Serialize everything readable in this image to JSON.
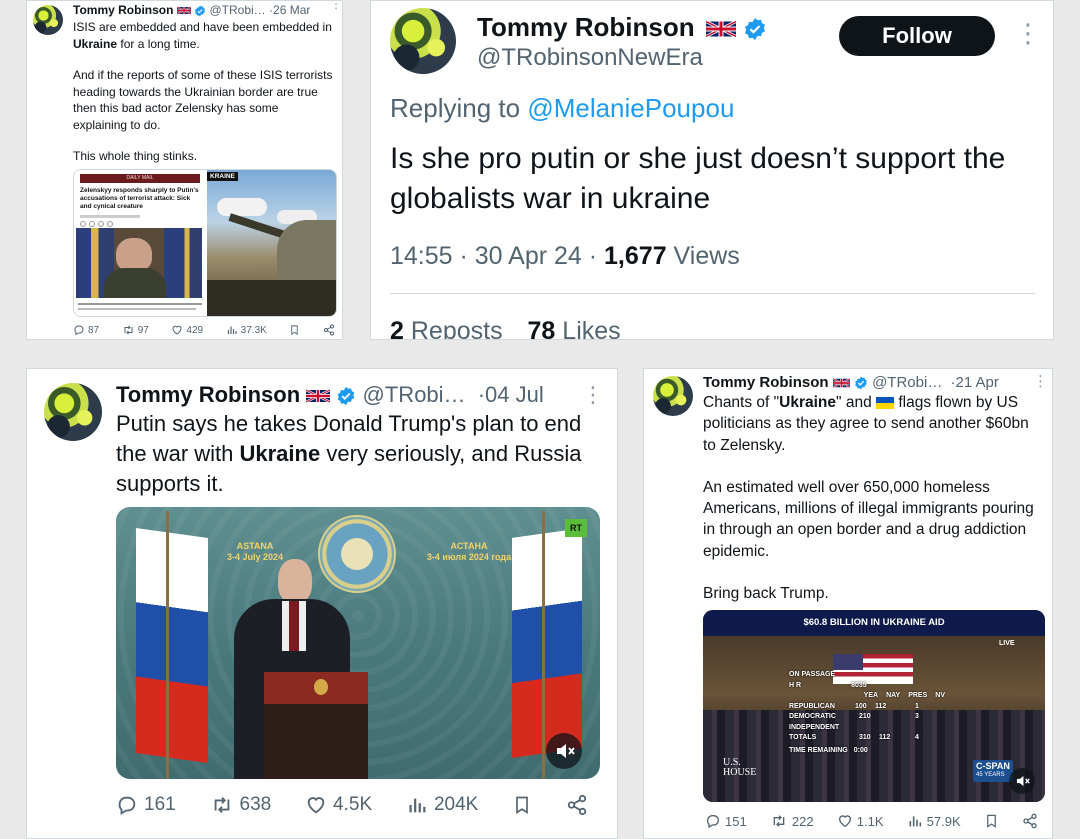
{
  "tweet1": {
    "name": "Tommy Robinson",
    "handle": "@TRobi…",
    "date": "26 Mar",
    "text_p1_a": "ISIS are embedded  and have been embedded in ",
    "text_p1_kw": "Ukraine",
    "text_p1_b": " for a long time.",
    "text_p2": "And if the reports of some of these ISIS terrorists heading towards the Ukrainian border are true then this bad actor Zelensky has some explaining to do.",
    "text_p3": "This whole thing stinks.",
    "article_masthead": "DAILY MAIL",
    "article_tag": "KRAINE",
    "article_headline": "Zelenskyy responds sharply to Putin's accusations of terrorist attack: Sick and cynical creature",
    "stats": {
      "replies": "87",
      "reposts": "97",
      "likes": "429",
      "views": "37.3K"
    }
  },
  "tweet2": {
    "name": "Tommy Robinson",
    "handle": "@TRobinsonNewEra",
    "follow_label": "Follow",
    "replying_prefix": "Replying to ",
    "replying_to": "@MelaniePoupou",
    "text": "Is she pro putin or she just doesn’t support the globalists war in ukraine",
    "time": "14:55",
    "date": "30 Apr 24",
    "views_count": "1,677",
    "views_label": "Views",
    "reposts_count": "2",
    "reposts_label": "Reposts",
    "likes_count": "78",
    "likes_label": "Likes"
  },
  "tweet3": {
    "name": "Tommy Robinson",
    "handle": "@TRobi…",
    "date": "04 Jul",
    "text_a": "Putin says he takes Donald Trump's plan to end the war with ",
    "text_kw": "Ukraine",
    "text_b": " very seriously, and Russia supports it.",
    "video": {
      "left_banner_1": "ASTANA",
      "left_banner_2": "3-4 July 2024",
      "right_banner_1": "АСТАНА",
      "right_banner_2": "3-4 июля 2024 года",
      "channel_badge": "RT"
    },
    "stats": {
      "replies": "161",
      "reposts": "638",
      "likes": "4.5K",
      "views": "204K"
    }
  },
  "tweet4": {
    "name": "Tommy Robinson",
    "handle": "@TRobi…",
    "date": "21 Apr",
    "text_p1_a": "Chants of \"",
    "text_p1_kw": "Ukraine",
    "text_p1_b": "\" and ",
    "text_p1_c": " flags flown by US politicians as they agree to send another $60bn to Zelensky.",
    "text_p2": "An estimated well over 650,000 homeless Americans, millions of illegal immigrants pouring in through an open border and a drug addiction epidemic.",
    "text_p3": "Bring back Trump.",
    "video": {
      "banner": "$60.8 BILLION IN UKRAINE AID",
      "live": "LIVE",
      "on_passage": "ON PASSAGE",
      "hr_label": "H R",
      "hr_number": "8035",
      "col_yea": "YEA",
      "col_nay": "NAY",
      "col_pres": "PRES",
      "col_nv": "NV",
      "row1_label": "REPUBLICAN",
      "row1_yea": "100",
      "row1_nay": "112",
      "row1_nv": "1",
      "row2_label": "DEMOCRATIC",
      "row2_yea": "210",
      "row2_nv": "3",
      "row3_label": "INDEPENDENT",
      "row4_label": "TOTALS",
      "row4_yea": "310",
      "row4_nay": "112",
      "row4_nv": "4",
      "time_remaining": "TIME REMAINING",
      "time_value": "0:00",
      "house_logo_1": "U.S.",
      "house_logo_2": "HOUSE",
      "cspan_logo": "C-SPAN",
      "cspan_sub": "45 YEARS"
    },
    "stats": {
      "replies": "151",
      "reposts": "222",
      "likes": "1.1K",
      "views": "57.9K"
    }
  },
  "colors": {
    "verified": "#1d9bf0",
    "link": "#1d9bf0",
    "text": "#0f1419",
    "muted": "#536471"
  },
  "icons": [
    "verified-badge-icon",
    "uk-flag-icon",
    "ukraine-flag-icon",
    "reply-icon",
    "repost-icon",
    "like-icon",
    "views-icon",
    "bookmark-icon",
    "share-icon",
    "mute-icon",
    "more-icon"
  ]
}
